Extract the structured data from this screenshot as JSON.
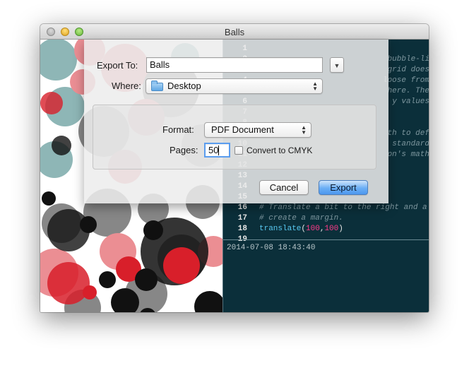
{
  "window": {
    "title": "Balls"
  },
  "dialog": {
    "export_to_label": "Export To:",
    "export_to_value": "Balls",
    "where_label": "Where:",
    "where_value": "Desktop",
    "format_label": "Format:",
    "format_value": "PDF Document",
    "pages_label": "Pages:",
    "pages_value": "50",
    "convert_cmyk_label": "Convert to CMYK",
    "convert_cmyk_checked": false,
    "cancel_label": "Cancel",
    "export_label": "Export"
  },
  "editor": {
    "lines": [
      {
        "num": "1",
        "code": "",
        "style": "comment"
      },
      {
        "num": "2",
        "code": "bubble-li",
        "style": "comment"
      },
      {
        "num": "3",
        "code": "grid does",
        "style": "comment"
      },
      {
        "num": "4",
        "code": "loose from",
        "style": "comment"
      },
      {
        "num": "5",
        "code": "here. The",
        "style": "comment"
      },
      {
        "num": "6",
        "code": "y values",
        "style": "comment"
      },
      {
        "num": "7",
        "code": "",
        "style": "comment"
      },
      {
        "num": "8",
        "code": "",
        "style": "comment"
      },
      {
        "num": "9",
        "code": "th to def",
        "style": "comment"
      },
      {
        "num": "10",
        "code": "standard",
        "style": "comment"
      },
      {
        "num": "11",
        "code": "on's math",
        "style": "comment"
      },
      {
        "num": "12",
        "code": "",
        "style": "comment"
      },
      {
        "num": "13",
        "code": "",
        "style": "comment"
      },
      {
        "num": "14",
        "code": "",
        "style": "comment"
      },
      {
        "num": "15",
        "code": "",
        "style": "comment"
      },
      {
        "num": "16",
        "code": "# Translate a bit to the right and a",
        "style": "comment"
      },
      {
        "num": "17",
        "code": "# create a margin.",
        "style": "comment"
      },
      {
        "num": "18",
        "code": "translate(100,100)",
        "style": "call"
      },
      {
        "num": "19",
        "code": "",
        "style": "plain"
      }
    ],
    "translate_fn": "translate",
    "translate_args": [
      "100",
      "100"
    ],
    "console_output": "2014-07-08 18:43:40"
  },
  "colors": {
    "editor_bg": "#0b2f3a",
    "keyword": "#58c9f2",
    "number": "#ff3b8a",
    "ball_red": "#d81f2a",
    "ball_dark": "#111111",
    "ball_teal": "#1f6f6f"
  },
  "icons": {
    "where_popup": "folder-icon",
    "export_to_disclosure": "chevron-down-icon",
    "popup_arrows": "updown-chevrons-icon"
  }
}
